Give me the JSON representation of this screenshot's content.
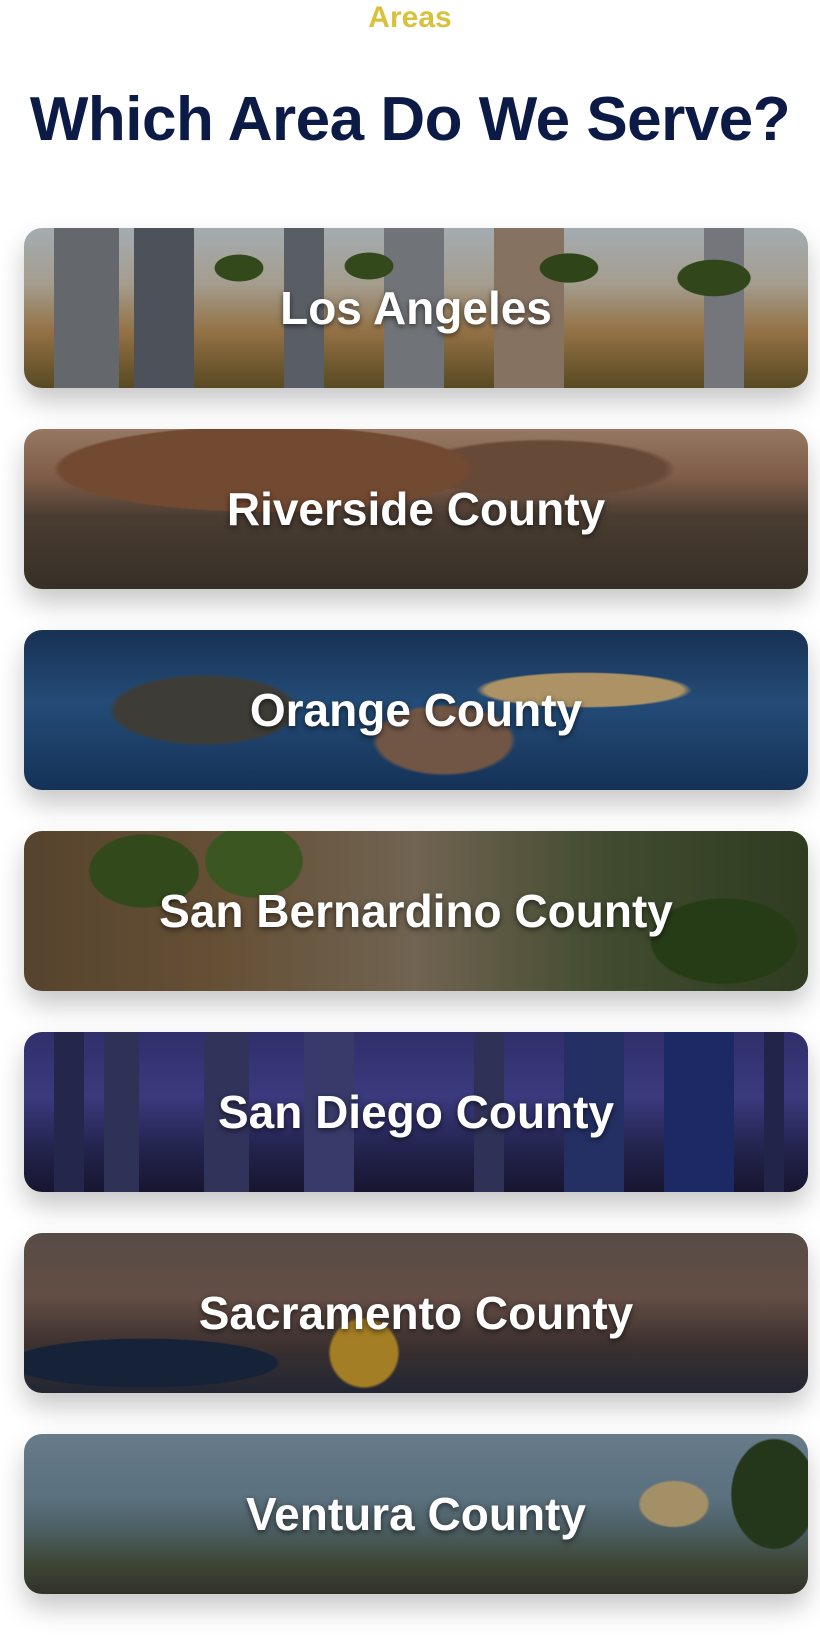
{
  "eyebrow": "Areas",
  "title": "Which Area Do We Serve?",
  "areas": [
    {
      "label": "Los Angeles",
      "scene": "city-skyline-palms"
    },
    {
      "label": "Riverside County",
      "scene": "mountain-valley-city"
    },
    {
      "label": "Orange County",
      "scene": "harbor-peninsula-ocean"
    },
    {
      "label": "San Bernardino County",
      "scene": "neighborhood-palms"
    },
    {
      "label": "San Diego County",
      "scene": "night-skyline-bay"
    },
    {
      "label": "Sacramento County",
      "scene": "riverfront-bridge"
    },
    {
      "label": "Ventura County",
      "scene": "beach-pier-coast"
    }
  ]
}
